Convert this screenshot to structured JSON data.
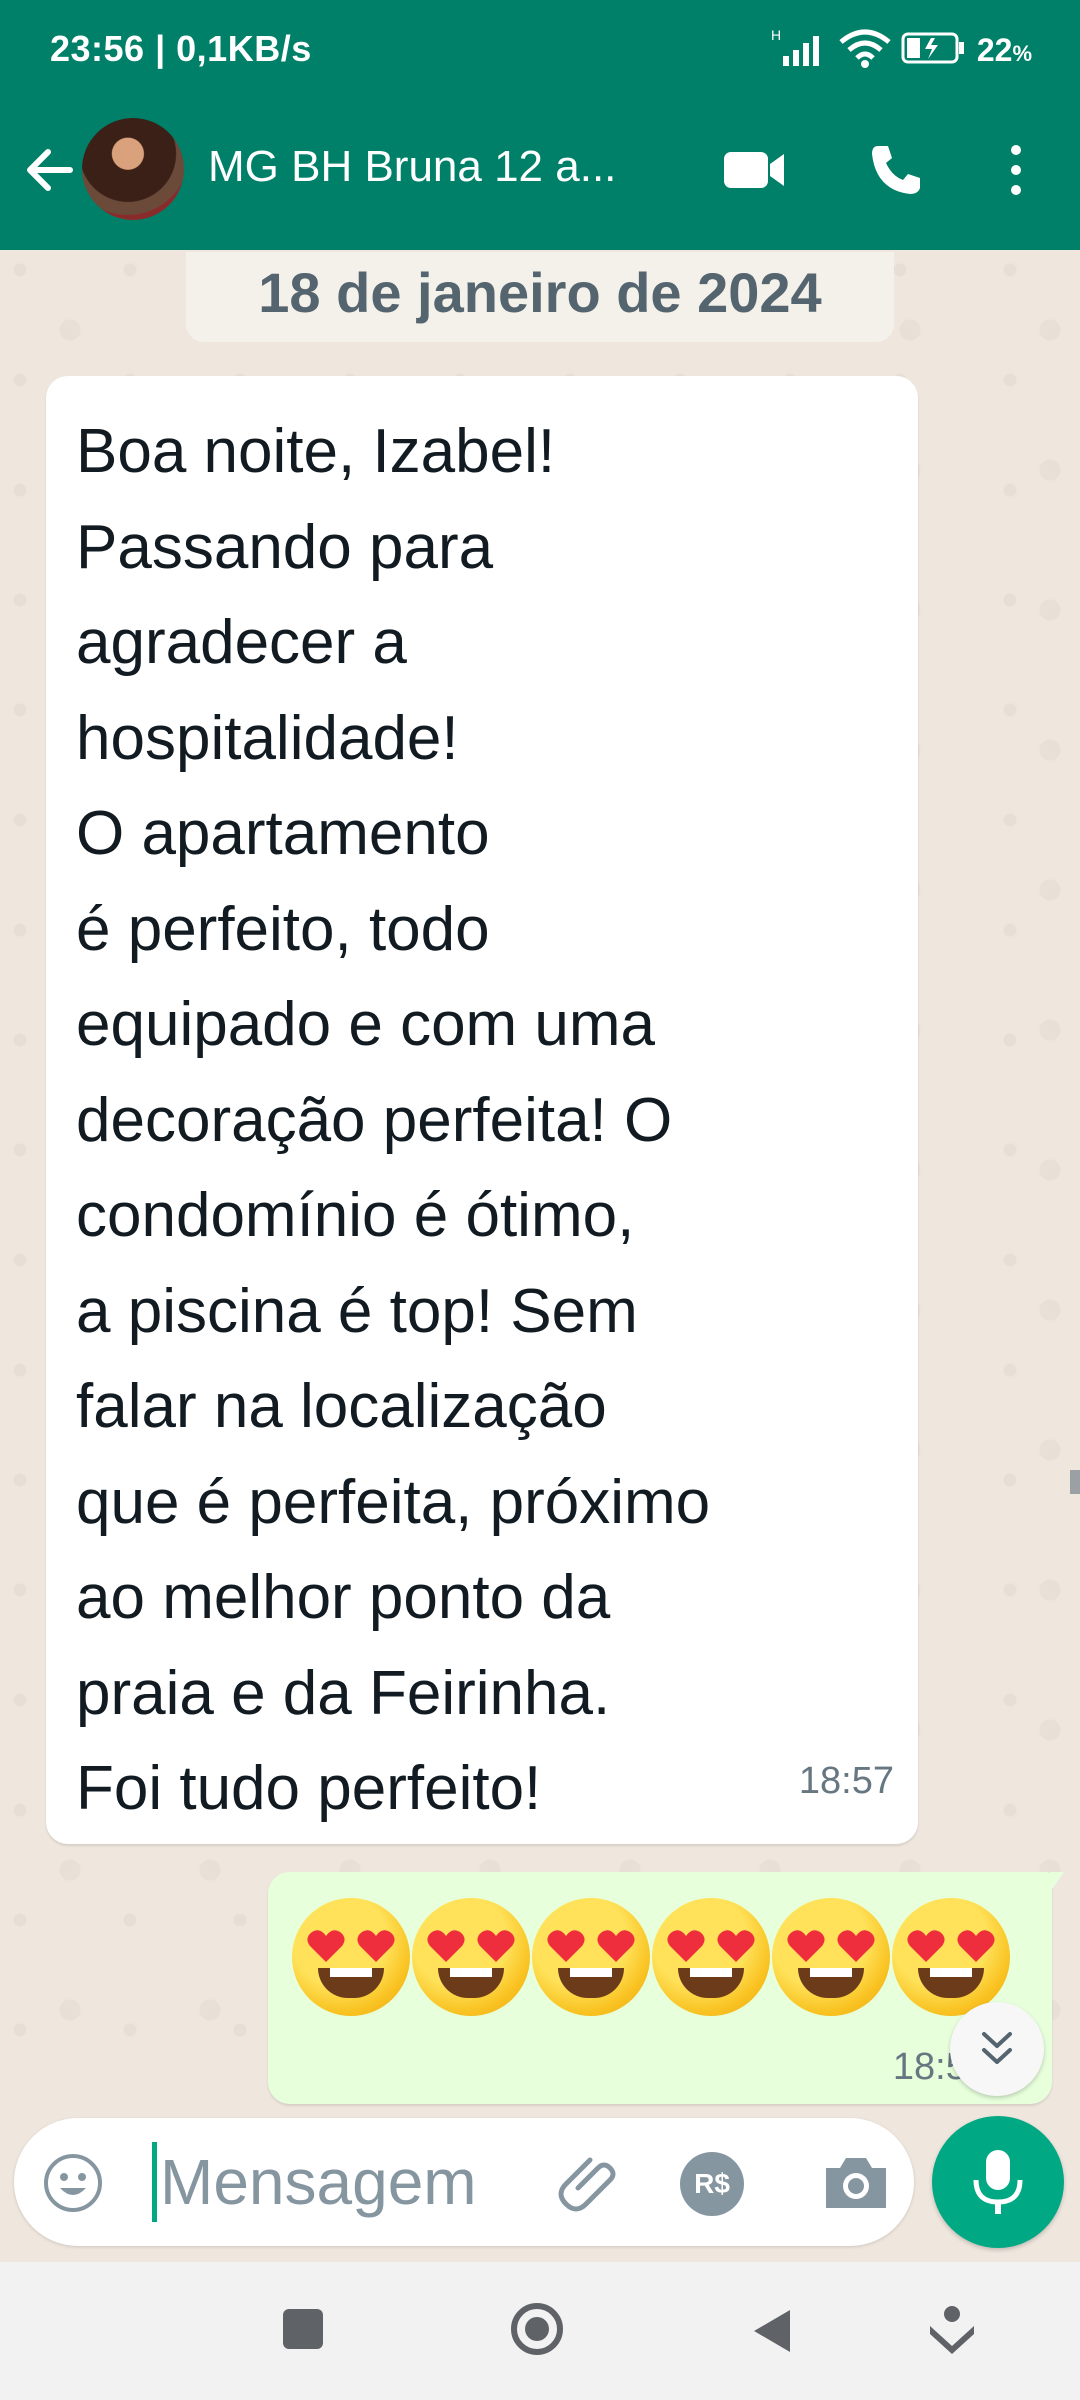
{
  "status_bar": {
    "time_speed": "23:56 | 0,1KB/s",
    "network_type": "H",
    "battery_percent": "22",
    "battery_unit": "%"
  },
  "header": {
    "chat_title": "MG BH Bruna 12 a..."
  },
  "chat": {
    "date_label": "18 de janeiro de 2024",
    "incoming": {
      "text": "Boa noite, Izabel!\nPassando para\nagradecer a\nhospitalidade!\nO apartamento\né perfeito, todo\nequipado e com uma\ndecoração perfeita! O\ncondomínio é ótimo,\na piscina é top! Sem\nfalar na localização\nque é perfeita, próximo\nao melhor ponto da\npraia e da Feirinha.\nFoi tudo perfeito!",
      "time": "18:57"
    },
    "outgoing": {
      "emoji_count": 6,
      "emoji": "smiling-face-with-heart-eyes",
      "time": "18:57"
    }
  },
  "composer": {
    "placeholder": "Mensagem",
    "pay_label": "R$"
  },
  "colors": {
    "header": "#008069",
    "accent": "#00a884",
    "incoming_bubble": "#ffffff",
    "outgoing_bubble": "#e7ffdb",
    "chat_bg": "#efe7de"
  }
}
